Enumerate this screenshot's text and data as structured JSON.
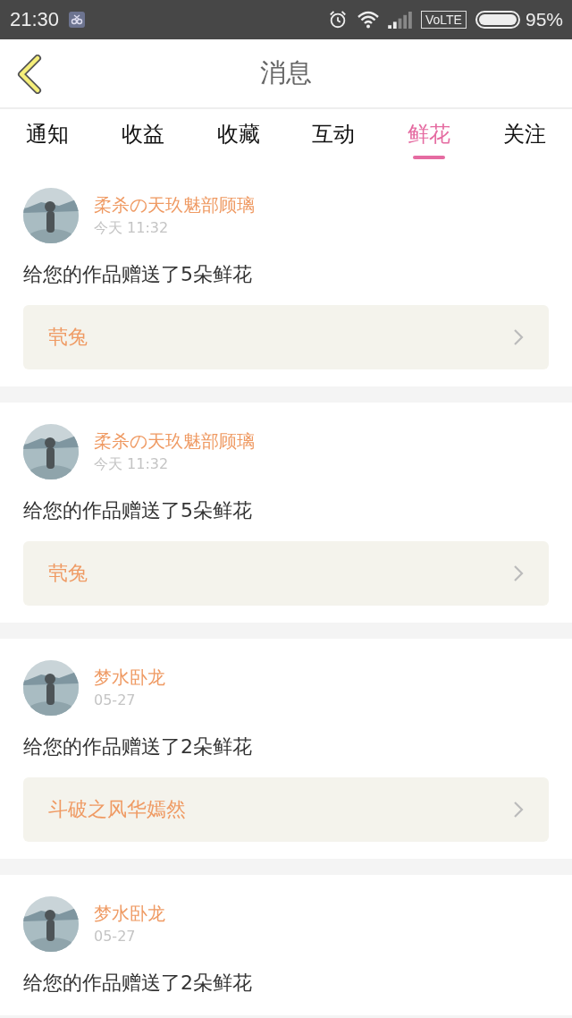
{
  "status_bar": {
    "time": "21:30",
    "network": "VoLTE",
    "battery": "95%"
  },
  "header": {
    "title": "消息"
  },
  "tabs": [
    {
      "label": "通知",
      "selected": false
    },
    {
      "label": "收益",
      "selected": false
    },
    {
      "label": "收藏",
      "selected": false
    },
    {
      "label": "互动",
      "selected": false
    },
    {
      "label": "鲜花",
      "selected": true
    },
    {
      "label": "关注",
      "selected": false
    }
  ],
  "messages": [
    {
      "user": "柔杀の天玖魅部顾璃",
      "time": "今天 11:32",
      "text": "给您的作品赠送了5朵鲜花",
      "work": "茕兔"
    },
    {
      "user": "柔杀の天玖魅部顾璃",
      "time": "今天 11:32",
      "text": "给您的作品赠送了5朵鲜花",
      "work": "茕兔"
    },
    {
      "user": "梦水卧龙",
      "time": "05-27",
      "text": "给您的作品赠送了2朵鲜花",
      "work": "斗破之风华嫣然"
    },
    {
      "user": "梦水卧龙",
      "time": "05-27",
      "text": "给您的作品赠送了2朵鲜花"
    }
  ]
}
